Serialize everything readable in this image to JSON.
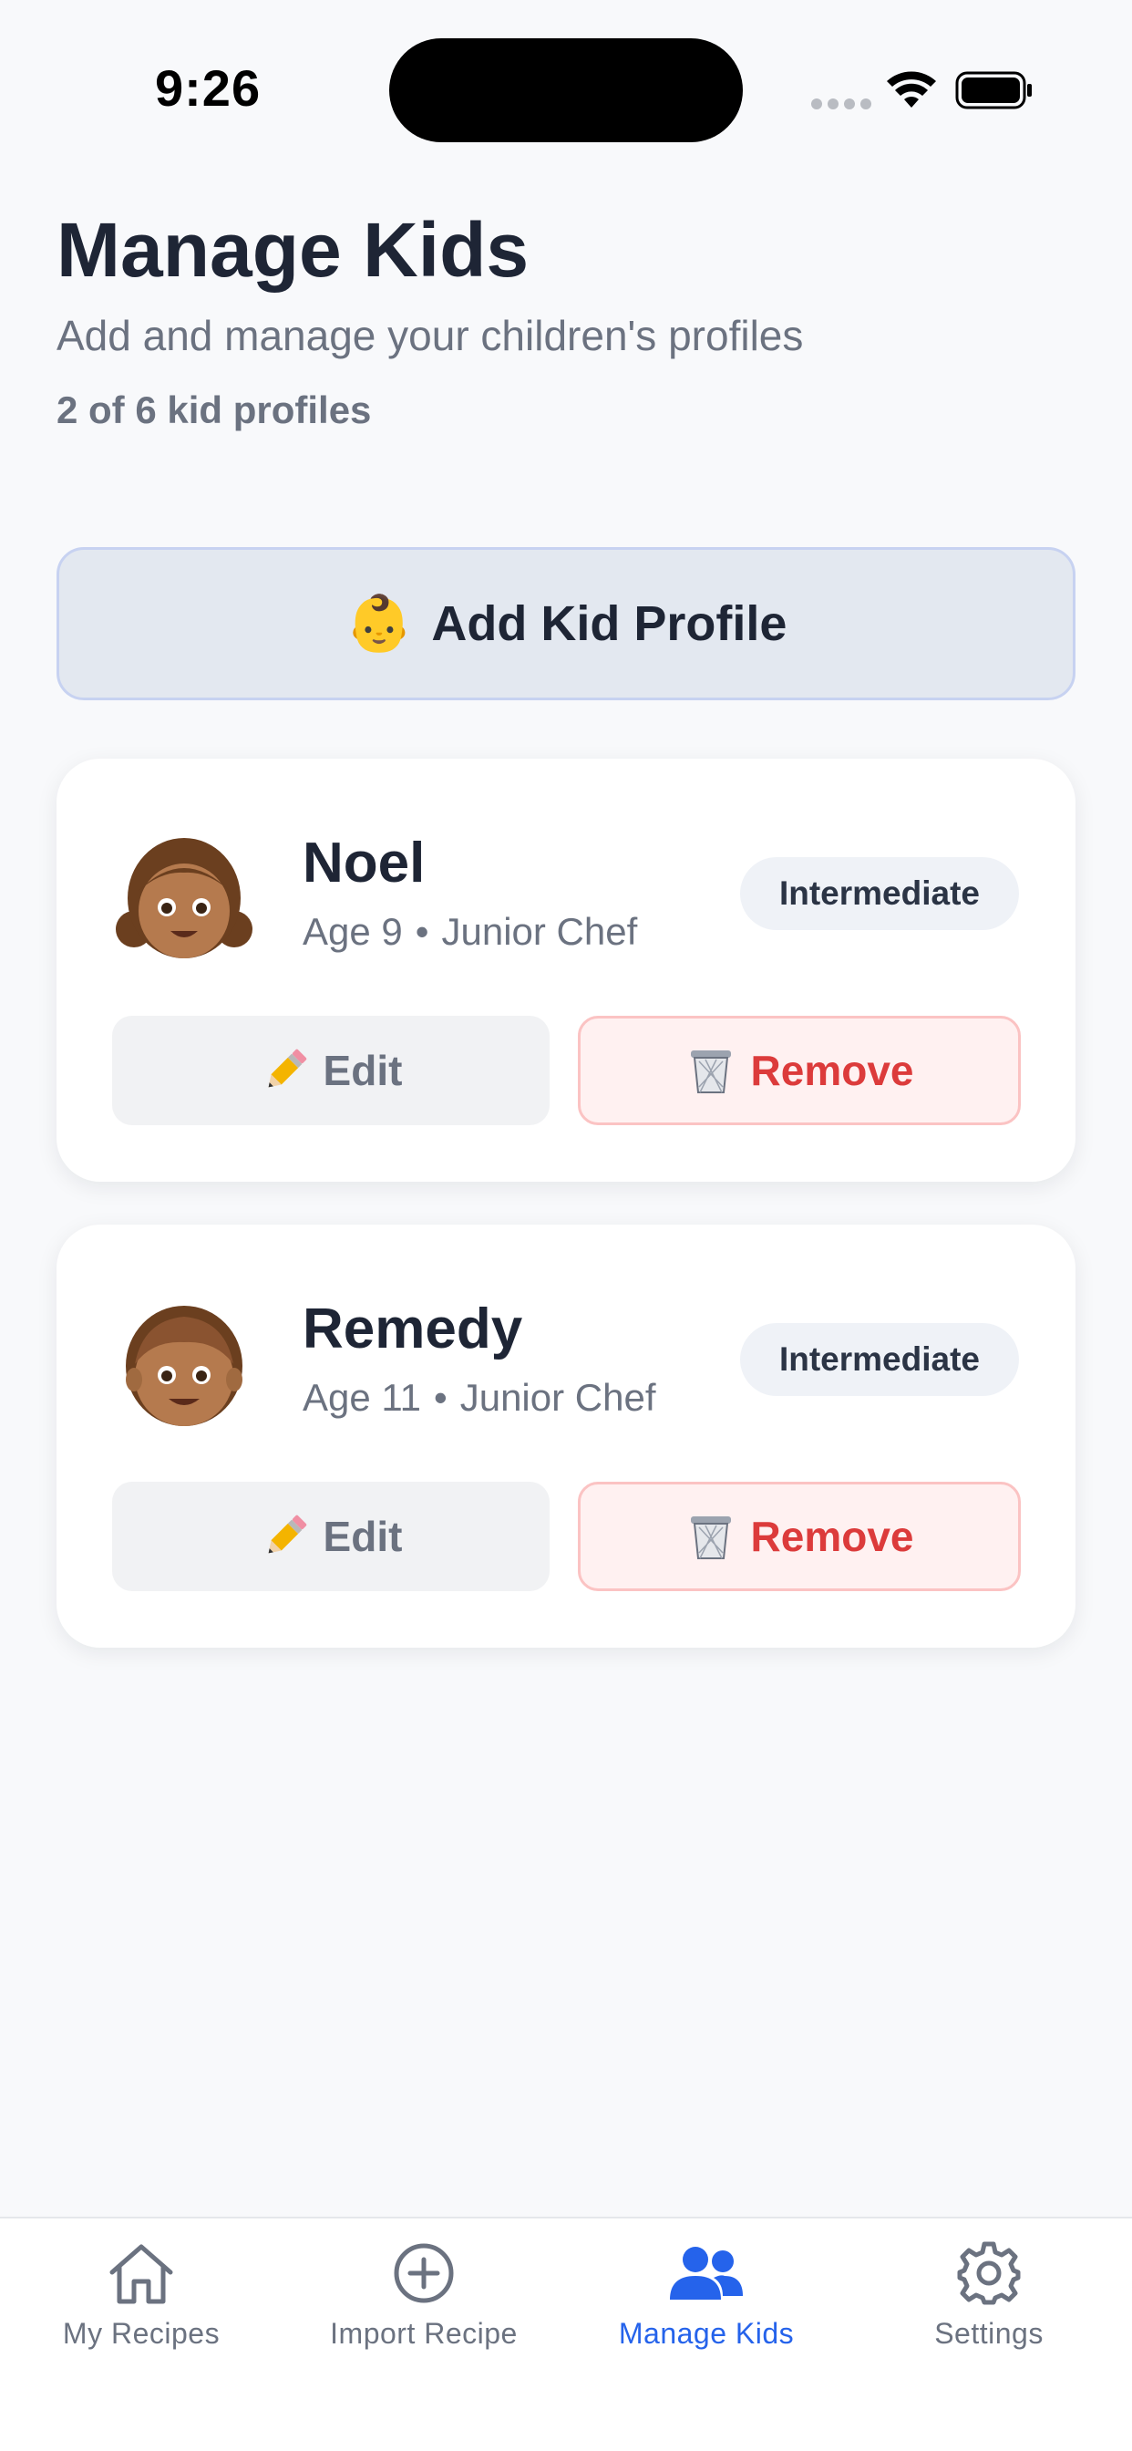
{
  "status_bar": {
    "time": "9:26"
  },
  "header": {
    "title": "Manage Kids",
    "subtitle": "Add and manage your children's profiles",
    "profile_count": "2 of 6 kid profiles"
  },
  "add_button": {
    "emoji": "👶",
    "label": "Add Kid Profile"
  },
  "kids": [
    {
      "avatar": "👧🏽",
      "name": "Noel",
      "age": "Age 9",
      "separator": "•",
      "title": "Junior Chef",
      "level": "Intermediate",
      "edit_emoji": "✏️",
      "edit_label": "Edit",
      "remove_emoji": "🗑️",
      "remove_label": "Remove"
    },
    {
      "avatar": "👦🏽",
      "name": "Remedy",
      "age": "Age 11",
      "separator": "•",
      "title": "Junior Chef",
      "level": "Intermediate",
      "edit_emoji": "✏️",
      "edit_label": "Edit",
      "remove_emoji": "🗑️",
      "remove_label": "Remove"
    }
  ],
  "tab_bar": {
    "active_color": "#2563eb",
    "inactive_color": "#6b7280",
    "tabs": [
      {
        "label": "My Recipes",
        "icon": "home-icon",
        "active": false
      },
      {
        "label": "Import Recipe",
        "icon": "plus-circle-icon",
        "active": false
      },
      {
        "label": "Manage Kids",
        "icon": "people-icon",
        "active": true
      },
      {
        "label": "Settings",
        "icon": "gear-icon",
        "active": false
      }
    ]
  }
}
